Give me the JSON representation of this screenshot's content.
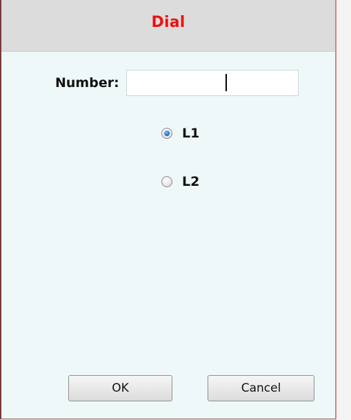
{
  "dialog": {
    "title": "Dial",
    "title_color": "#ee1111"
  },
  "number": {
    "label": "Number:",
    "value": "",
    "placeholder": ""
  },
  "lines": [
    {
      "label": "L1",
      "selected": true
    },
    {
      "label": "L2",
      "selected": false
    }
  ],
  "buttons": {
    "ok_label": "OK",
    "cancel_label": "Cancel"
  }
}
